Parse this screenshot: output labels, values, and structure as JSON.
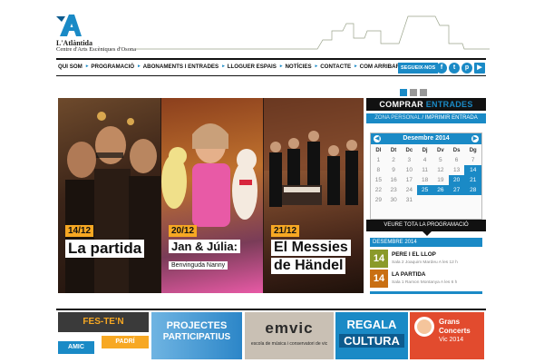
{
  "header": {
    "logo_name": "L'Atlàntida",
    "logo_sub": "Centre d'Arts Escèniques d'Osona"
  },
  "nav": {
    "items": [
      "QUI SOM",
      "PROGRAMACIÓ",
      "ABONAMENTS I ENTRADES",
      "LLOGUER ESPAIS",
      "NOTÍCIES",
      "CONTACTE",
      "COM ARRIBAR-HI"
    ],
    "follow": "SEGUEIX-NOS",
    "social": [
      {
        "icon": "facebook-icon",
        "glyph": "f"
      },
      {
        "icon": "twitter-icon",
        "glyph": "t"
      },
      {
        "icon": "pinterest-icon",
        "glyph": "p"
      },
      {
        "icon": "youtube-icon",
        "glyph": "▶"
      }
    ]
  },
  "slider": {
    "active_index": 0,
    "count": 3
  },
  "banner": [
    {
      "date": "14/12",
      "title": "La partida",
      "subtitle": ""
    },
    {
      "date": "20/12",
      "title": "Jan & Júlia:",
      "subtitle": "Benvinguda Nanny"
    },
    {
      "date": "21/12",
      "title": "El Messies",
      "title2": "de Händel"
    }
  ],
  "tickets": {
    "title_a": "COMPRAR ",
    "title_b": "ENTRADES",
    "zone_a": "ZONA PERSONAL",
    "zone_sep": " / ",
    "zone_b": "IMPRIMIR ENTRADA",
    "calendar": {
      "month": "Desembre 2014",
      "weekdays": [
        "Dl",
        "Dt",
        "Dc",
        "Dj",
        "Dv",
        "Ds",
        "Dg"
      ],
      "weeks": [
        [
          "1",
          "2",
          "3",
          "4",
          "5",
          "6",
          "7"
        ],
        [
          "8",
          "9",
          "10",
          "11",
          "12",
          "13",
          "14"
        ],
        [
          "15",
          "16",
          "17",
          "18",
          "19",
          "20",
          "21"
        ],
        [
          "22",
          "23",
          "24",
          "25",
          "26",
          "27",
          "28"
        ],
        [
          "29",
          "30",
          "31",
          "",
          "",
          "",
          ""
        ]
      ],
      "event_days": [
        "14",
        "20",
        "21",
        "25",
        "26",
        "27",
        "28"
      ]
    },
    "view_all": "VEURE TOTA LA PROGRAMACIÓ",
    "list_month": "DESEMBRE 2014",
    "events": [
      {
        "day": "14",
        "title": "PERE I EL LLOP",
        "details": "Sala 2 Joaquim Mardeu A les 12 h",
        "color": "#8a9a2a"
      },
      {
        "day": "14",
        "title": "LA PARTIDA",
        "details": "Sala 1 Ramon Montanya A les 6 h",
        "color": "#c96f12"
      }
    ]
  },
  "promos": {
    "fes_te": "FES-TE'N",
    "amic": "AMIC",
    "padri": "PADRÍ",
    "projectes_1": "PROJECTES",
    "projectes_2": "PARTICIPATIUS",
    "emvic": "emvic",
    "emvic_caption": "escola de música i conservatori de vic",
    "regala_1": "REGALA",
    "regala_2": "CULTURA",
    "grans_1": "Grans",
    "grans_2": "Concerts",
    "grans_3": "Vic 2014"
  },
  "colors": {
    "accent": "#1a8ac6",
    "orange": "#f7a823"
  }
}
